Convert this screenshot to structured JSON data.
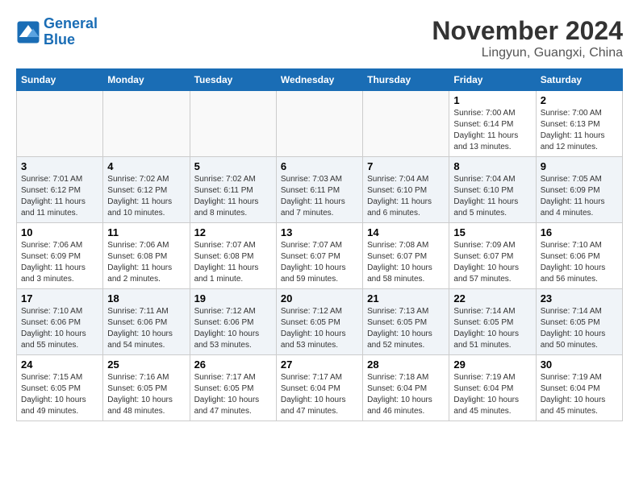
{
  "header": {
    "logo_line1": "General",
    "logo_line2": "Blue",
    "month": "November 2024",
    "location": "Lingyun, Guangxi, China"
  },
  "weekdays": [
    "Sunday",
    "Monday",
    "Tuesday",
    "Wednesday",
    "Thursday",
    "Friday",
    "Saturday"
  ],
  "weeks": [
    [
      {
        "day": "",
        "info": ""
      },
      {
        "day": "",
        "info": ""
      },
      {
        "day": "",
        "info": ""
      },
      {
        "day": "",
        "info": ""
      },
      {
        "day": "",
        "info": ""
      },
      {
        "day": "1",
        "info": "Sunrise: 7:00 AM\nSunset: 6:14 PM\nDaylight: 11 hours\nand 13 minutes."
      },
      {
        "day": "2",
        "info": "Sunrise: 7:00 AM\nSunset: 6:13 PM\nDaylight: 11 hours\nand 12 minutes."
      }
    ],
    [
      {
        "day": "3",
        "info": "Sunrise: 7:01 AM\nSunset: 6:12 PM\nDaylight: 11 hours\nand 11 minutes."
      },
      {
        "day": "4",
        "info": "Sunrise: 7:02 AM\nSunset: 6:12 PM\nDaylight: 11 hours\nand 10 minutes."
      },
      {
        "day": "5",
        "info": "Sunrise: 7:02 AM\nSunset: 6:11 PM\nDaylight: 11 hours\nand 8 minutes."
      },
      {
        "day": "6",
        "info": "Sunrise: 7:03 AM\nSunset: 6:11 PM\nDaylight: 11 hours\nand 7 minutes."
      },
      {
        "day": "7",
        "info": "Sunrise: 7:04 AM\nSunset: 6:10 PM\nDaylight: 11 hours\nand 6 minutes."
      },
      {
        "day": "8",
        "info": "Sunrise: 7:04 AM\nSunset: 6:10 PM\nDaylight: 11 hours\nand 5 minutes."
      },
      {
        "day": "9",
        "info": "Sunrise: 7:05 AM\nSunset: 6:09 PM\nDaylight: 11 hours\nand 4 minutes."
      }
    ],
    [
      {
        "day": "10",
        "info": "Sunrise: 7:06 AM\nSunset: 6:09 PM\nDaylight: 11 hours\nand 3 minutes."
      },
      {
        "day": "11",
        "info": "Sunrise: 7:06 AM\nSunset: 6:08 PM\nDaylight: 11 hours\nand 2 minutes."
      },
      {
        "day": "12",
        "info": "Sunrise: 7:07 AM\nSunset: 6:08 PM\nDaylight: 11 hours\nand 1 minute."
      },
      {
        "day": "13",
        "info": "Sunrise: 7:07 AM\nSunset: 6:07 PM\nDaylight: 10 hours\nand 59 minutes."
      },
      {
        "day": "14",
        "info": "Sunrise: 7:08 AM\nSunset: 6:07 PM\nDaylight: 10 hours\nand 58 minutes."
      },
      {
        "day": "15",
        "info": "Sunrise: 7:09 AM\nSunset: 6:07 PM\nDaylight: 10 hours\nand 57 minutes."
      },
      {
        "day": "16",
        "info": "Sunrise: 7:10 AM\nSunset: 6:06 PM\nDaylight: 10 hours\nand 56 minutes."
      }
    ],
    [
      {
        "day": "17",
        "info": "Sunrise: 7:10 AM\nSunset: 6:06 PM\nDaylight: 10 hours\nand 55 minutes."
      },
      {
        "day": "18",
        "info": "Sunrise: 7:11 AM\nSunset: 6:06 PM\nDaylight: 10 hours\nand 54 minutes."
      },
      {
        "day": "19",
        "info": "Sunrise: 7:12 AM\nSunset: 6:06 PM\nDaylight: 10 hours\nand 53 minutes."
      },
      {
        "day": "20",
        "info": "Sunrise: 7:12 AM\nSunset: 6:05 PM\nDaylight: 10 hours\nand 53 minutes."
      },
      {
        "day": "21",
        "info": "Sunrise: 7:13 AM\nSunset: 6:05 PM\nDaylight: 10 hours\nand 52 minutes."
      },
      {
        "day": "22",
        "info": "Sunrise: 7:14 AM\nSunset: 6:05 PM\nDaylight: 10 hours\nand 51 minutes."
      },
      {
        "day": "23",
        "info": "Sunrise: 7:14 AM\nSunset: 6:05 PM\nDaylight: 10 hours\nand 50 minutes."
      }
    ],
    [
      {
        "day": "24",
        "info": "Sunrise: 7:15 AM\nSunset: 6:05 PM\nDaylight: 10 hours\nand 49 minutes."
      },
      {
        "day": "25",
        "info": "Sunrise: 7:16 AM\nSunset: 6:05 PM\nDaylight: 10 hours\nand 48 minutes."
      },
      {
        "day": "26",
        "info": "Sunrise: 7:17 AM\nSunset: 6:05 PM\nDaylight: 10 hours\nand 47 minutes."
      },
      {
        "day": "27",
        "info": "Sunrise: 7:17 AM\nSunset: 6:04 PM\nDaylight: 10 hours\nand 47 minutes."
      },
      {
        "day": "28",
        "info": "Sunrise: 7:18 AM\nSunset: 6:04 PM\nDaylight: 10 hours\nand 46 minutes."
      },
      {
        "day": "29",
        "info": "Sunrise: 7:19 AM\nSunset: 6:04 PM\nDaylight: 10 hours\nand 45 minutes."
      },
      {
        "day": "30",
        "info": "Sunrise: 7:19 AM\nSunset: 6:04 PM\nDaylight: 10 hours\nand 45 minutes."
      }
    ]
  ]
}
